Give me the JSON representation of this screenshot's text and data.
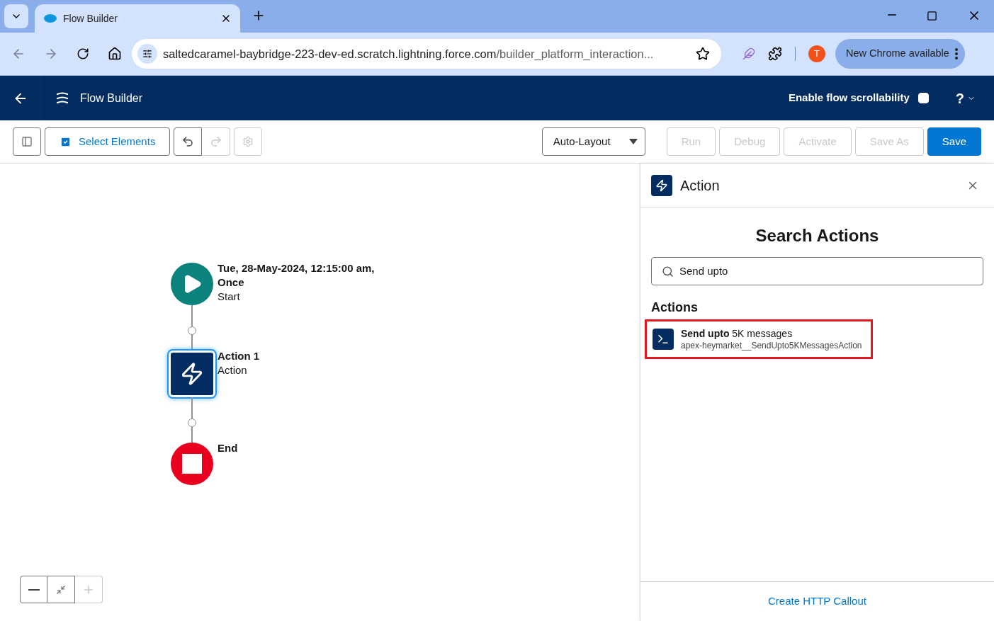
{
  "browser": {
    "tab_title": "Flow Builder",
    "url_host": "saltedcaramel-baybridge-223-dev-ed.scratch.lightning.force.com",
    "url_path": "/builder_platform_interaction...",
    "profile_initial": "T",
    "update_button": "New Chrome available"
  },
  "app_header": {
    "title": "Flow Builder",
    "scroll_toggle": {
      "label": "Enable flow scrollability",
      "checked": false
    },
    "help": "?"
  },
  "toolbar": {
    "select_elements": "Select Elements",
    "undo_disabled": false,
    "redo_disabled": true,
    "layout": "Auto-Layout",
    "buttons": [
      {
        "label": "Run",
        "kind": "neutral",
        "disabled": true
      },
      {
        "label": "Debug",
        "kind": "neutral",
        "disabled": true
      },
      {
        "label": "Activate",
        "kind": "neutral",
        "disabled": true
      },
      {
        "label": "Save As",
        "kind": "neutral",
        "disabled": true
      },
      {
        "label": "Save",
        "kind": "primary",
        "disabled": false
      }
    ]
  },
  "canvas": {
    "nodes": [
      {
        "kind": "start",
        "title": "Tue, 28-May-2024, 12:15:00 am, Once",
        "subtitle": "Start",
        "selected": false
      },
      {
        "kind": "action",
        "title": "Action 1",
        "subtitle": "Action",
        "selected": true
      },
      {
        "kind": "end",
        "title": "End",
        "selected": false
      }
    ],
    "zoom_in_disabled": true
  },
  "panel": {
    "title": "Action",
    "heading": "Search Actions",
    "search": {
      "value": "Send upto"
    },
    "section": "Actions",
    "results": [
      {
        "title": "**Send upto** 5K messages",
        "subtitle": "apex-heymarket__SendUpto5KMessagesAction",
        "highlighted": true
      }
    ],
    "footer_link": "Create HTTP Callout"
  }
}
